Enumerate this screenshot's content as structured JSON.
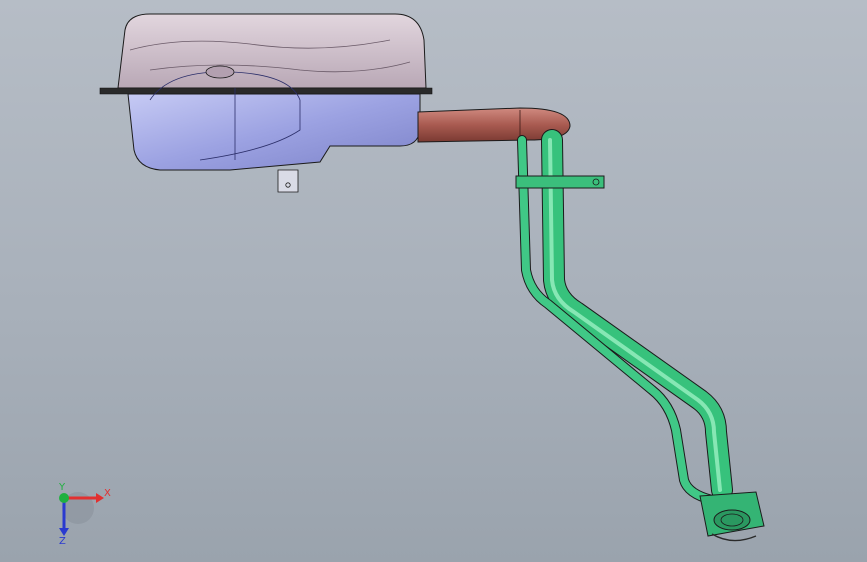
{
  "viewport": {
    "background_top": "#b6bdc6",
    "background_bottom": "#9aa3ad"
  },
  "model": {
    "tank_top_color": "#c8b8c4",
    "tank_bottom_color": "#9ea4e0",
    "inlet_pipe_color": "#a65a50",
    "filler_pipe_color": "#2fb872",
    "outline_color": "#1b1b1b"
  },
  "triad": {
    "x_label": "X",
    "y_label": "Y",
    "z_label": "Z",
    "x_color": "#e23030",
    "y_color": "#20b040",
    "z_color": "#2a3ad0"
  }
}
